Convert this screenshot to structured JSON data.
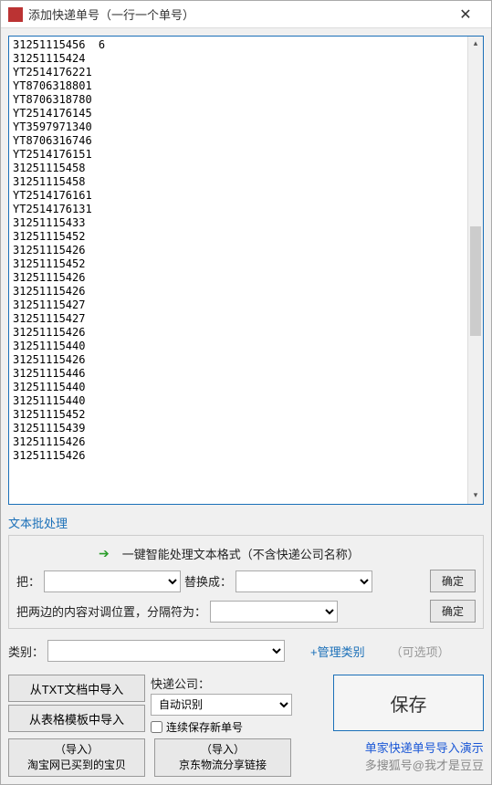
{
  "window": {
    "title": "添加快递单号（一行一个单号）"
  },
  "tracking_numbers": "31251115456  6\n31251115424\nYT2514176221\nYT8706318801\nYT8706318780\nYT2514176145\nYT3597971340\nYT8706316746\nYT2514176151\n31251115458\n31251115458\nYT2514176161\nYT2514176131\n31251115433\n31251115452\n31251115426\n31251115452\n31251115426\n31251115426\n31251115427\n31251115427\n31251115426\n31251115440\n31251115426\n31251115446\n31251115440\n31251115440\n31251115452\n31251115439\n31251115426\n31251115426\n",
  "batch": {
    "section_label": "文本批处理",
    "smart_format_text": "一键智能处理文本格式（不含快递公司名称）",
    "replace_label_from": "把：",
    "replace_label_to": "替换成：",
    "confirm_label": "确定",
    "swap_label": "把两边的内容对调位置，分隔符为：",
    "confirm_label2": "确定"
  },
  "category": {
    "label": "类别：",
    "manage_label": "+管理类别",
    "optional_label": "（可选项）"
  },
  "import": {
    "from_txt": "从TXT文档中导入",
    "from_sheet": "从表格模板中导入"
  },
  "company": {
    "label": "快递公司：",
    "selected": "自动识别",
    "continuous_save": "连续保存新单号"
  },
  "save_label": "保存",
  "footer": {
    "taobao_top": "（导入）",
    "taobao_bottom": "淘宝网已买到的宝贝",
    "jd_top": "（导入）",
    "jd_bottom": "京东物流分享链接",
    "link1": "单家快递单号导入演示",
    "link2": "多搜狐号@我才是豆豆"
  }
}
